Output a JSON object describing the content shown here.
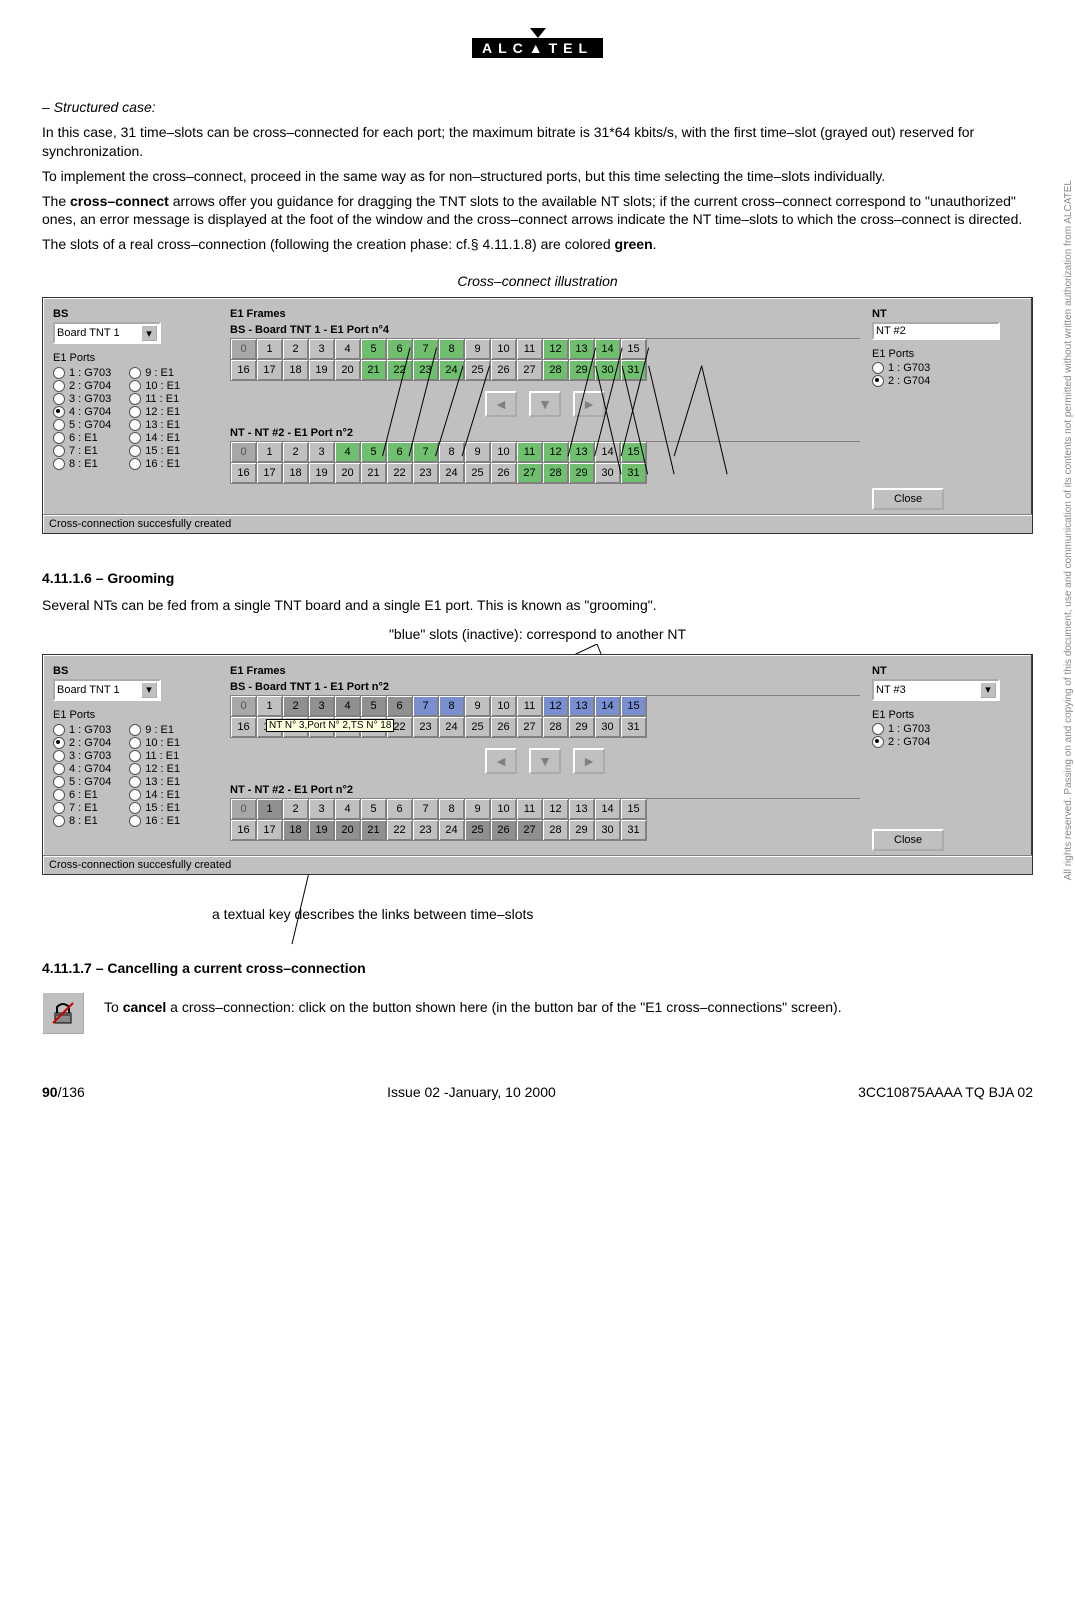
{
  "logo_text": "ALC▲TEL",
  "watermark": "All rights reserved. Passing on and copying of this document, use and communication of its contents not permitted without written authorization from ALCATEL",
  "intro": {
    "struct_label": "– Structured case:",
    "p1": "In this case, 31 time–slots can be cross–connected for each port; the maximum bitrate is 31*64 kbits/s, with the first time–slot (grayed out) reserved for synchronization.",
    "p2": "To implement the cross–connect, proceed in the same way as for non–structured ports, but this time selecting the time–slots individually.",
    "p3a": "The ",
    "p3_bold": "cross–connect",
    "p3b": " arrows offer you guidance for dragging the TNT slots to the available NT slots; if the current cross–connect correspond to \"unauthorized\" ones, an error message is displayed at the foot of the window and the cross–connect arrows indicate the NT time–slots to which the cross–connect is directed.",
    "p4a": "The slots of a real cross–connection (following the creation phase: cf.§ 4.11.1.8) are colored ",
    "p4_bold": "green",
    "p4b": "."
  },
  "caption1": "Cross–connect illustration",
  "win1": {
    "bs_label": "BS",
    "bs_board": "Board TNT  1",
    "e1_ports_label": "E1 Ports",
    "bs_ports_left": [
      {
        "label": "1 : G703",
        "sel": false
      },
      {
        "label": "2 : G704",
        "sel": false
      },
      {
        "label": "3 : G703",
        "sel": false
      },
      {
        "label": "4 : G704",
        "sel": true
      },
      {
        "label": "5 : G704",
        "sel": false
      },
      {
        "label": "6 : E1",
        "sel": false
      },
      {
        "label": "7 : E1",
        "sel": false
      },
      {
        "label": "8 : E1",
        "sel": false
      }
    ],
    "bs_ports_right": [
      {
        "label": "9 : E1",
        "sel": false
      },
      {
        "label": "10 : E1",
        "sel": false
      },
      {
        "label": "11 : E1",
        "sel": false
      },
      {
        "label": "12 : E1",
        "sel": false
      },
      {
        "label": "13 : E1",
        "sel": false
      },
      {
        "label": "14 : E1",
        "sel": false
      },
      {
        "label": "15 : E1",
        "sel": false
      },
      {
        "label": "16 : E1",
        "sel": false
      }
    ],
    "frames_label": "E1 Frames",
    "bs_grid_title": "BS - Board TNT  1 - E1 Port n°4",
    "nt_grid_title": "NT - NT #2 - E1 Port n°2",
    "nt_label": "NT",
    "nt_val": "NT #2",
    "nt_ports": [
      {
        "label": "1 : G703",
        "sel": false
      },
      {
        "label": "2 : G704",
        "sel": true
      }
    ],
    "close": "Close",
    "status": "Cross-connection succesfully created"
  },
  "section2": {
    "head": "4.11.1.6 – Grooming",
    "p": "Several NTs can be fed from a single TNT board and a single E1 port. This is known as \"grooming\".",
    "annot_top": "\"blue\" slots (inactive): correspond to another NT",
    "annot_bottom": "a textual key describes the links between time–slots"
  },
  "win2": {
    "bs_label": "BS",
    "bs_board": "Board TNT  1",
    "e1_ports_label": "E1 Ports",
    "bs_ports_left": [
      {
        "label": "1 : G703",
        "sel": false
      },
      {
        "label": "2 : G704",
        "sel": true
      },
      {
        "label": "3 : G703",
        "sel": false
      },
      {
        "label": "4 : G704",
        "sel": false
      },
      {
        "label": "5 : G704",
        "sel": false
      },
      {
        "label": "6 : E1",
        "sel": false
      },
      {
        "label": "7 : E1",
        "sel": false
      },
      {
        "label": "8 : E1",
        "sel": false
      }
    ],
    "bs_ports_right": [
      {
        "label": "9 : E1",
        "sel": false
      },
      {
        "label": "10 : E1",
        "sel": false
      },
      {
        "label": "11 : E1",
        "sel": false
      },
      {
        "label": "12 : E1",
        "sel": false
      },
      {
        "label": "13 : E1",
        "sel": false
      },
      {
        "label": "14 : E1",
        "sel": false
      },
      {
        "label": "15 : E1",
        "sel": false
      },
      {
        "label": "16 : E1",
        "sel": false
      }
    ],
    "frames_label": "E1 Frames",
    "bs_grid_title": "BS - Board TNT  1 - E1 Port n°2",
    "nt_grid_title": "NT - NT #2 - E1 Port n°2",
    "nt_label": "NT",
    "nt_val": "NT #3",
    "nt_ports": [
      {
        "label": "1 : G703",
        "sel": false
      },
      {
        "label": "2 : G704",
        "sel": true
      }
    ],
    "close": "Close",
    "status": "Cross-connection succesfully created",
    "tooltip": "NT N° 3,Port N° 2,TS N° 18"
  },
  "section3": {
    "head": "4.11.1.7 – Cancelling a current cross–connection",
    "p_a": "To ",
    "p_bold": "cancel",
    "p_b": " a cross–connection: click on the button shown here (in the button bar of the \"E1 cross–connections\" screen)."
  },
  "footer": {
    "left_bold": "90",
    "left_rest": "/136",
    "center": "Issue 02 -January, 10 2000",
    "right": "3CC10875AAAA TQ BJA 02"
  },
  "slots_0_31": [
    "0",
    "1",
    "2",
    "3",
    "4",
    "5",
    "6",
    "7",
    "8",
    "9",
    "10",
    "11",
    "12",
    "13",
    "14",
    "15",
    "16",
    "17",
    "18",
    "19",
    "20",
    "21",
    "22",
    "23",
    "24",
    "25",
    "26",
    "27",
    "28",
    "29",
    "30",
    "31"
  ],
  "win1_bs_green": [
    5,
    6,
    7,
    8,
    12,
    13,
    14,
    21,
    22,
    23,
    24,
    28,
    29,
    30,
    31
  ],
  "win1_nt_green": [
    4,
    5,
    6,
    7,
    11,
    12,
    13,
    15,
    27,
    28,
    29,
    31
  ],
  "win2_bs_grey": [
    2,
    3,
    4,
    5,
    6
  ],
  "win2_bs_blue": [
    7,
    8,
    12,
    13,
    14,
    15
  ],
  "win2_nt_grey1": [
    1,
    18,
    19,
    20,
    21,
    25,
    26,
    27
  ],
  "arrow_glyphs": {
    "left": "◄",
    "down": "▼",
    "right": "►"
  }
}
